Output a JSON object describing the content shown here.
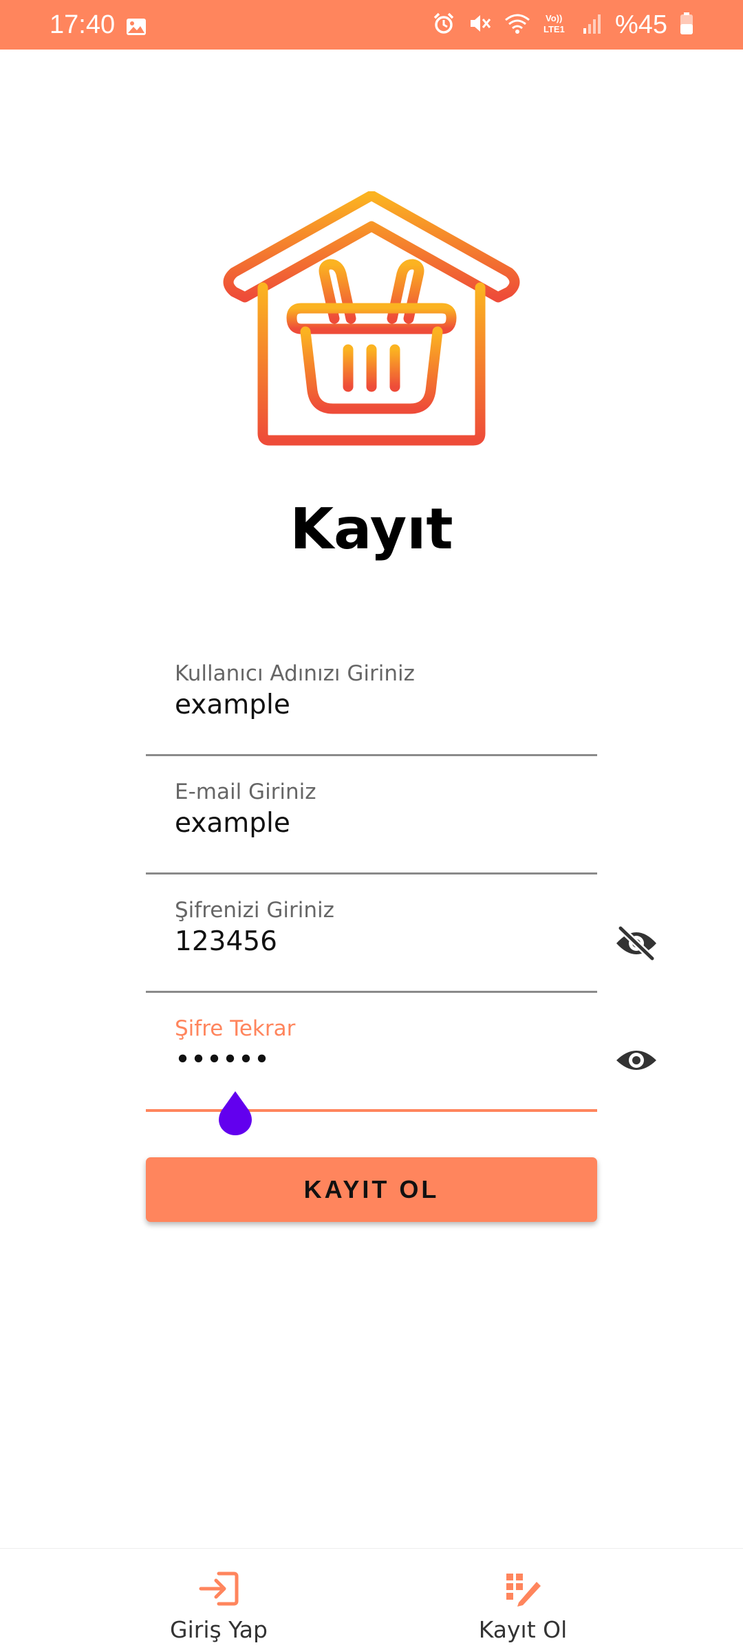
{
  "status_bar": {
    "time": "17:40",
    "battery": "%45",
    "icons": [
      "gallery-icon",
      "alarm-icon",
      "mute-icon",
      "wifi-icon",
      "volte-icon",
      "signal-icon",
      "battery-icon"
    ],
    "color": "#FF855D"
  },
  "logo": {
    "icon": "shopping-basket-home-icon"
  },
  "title": "Kayıt",
  "form": {
    "username": {
      "label": "Kullanıcı Adınızı Giriniz",
      "value": "example"
    },
    "email": {
      "label": "E-mail Giriniz",
      "value": "example"
    },
    "password": {
      "label": "Şifrenizi Giriniz",
      "value": "123456",
      "toggle_icon": "eye-off-icon"
    },
    "password_repeat": {
      "label": "Şifre Tekrar",
      "value": "••••••",
      "toggle_icon": "eye-icon",
      "focused": true
    },
    "submit_label": "KAYIT OL"
  },
  "bottom_nav": {
    "items": [
      {
        "label": "Giriş Yap",
        "icon": "login-icon"
      },
      {
        "label": "Kayıt Ol",
        "icon": "register-icon"
      }
    ]
  },
  "colors": {
    "accent": "#FF855D",
    "gradient_top": "#FBB321",
    "gradient_bottom": "#EE4C39",
    "cursor_handle": "#6200EE"
  }
}
